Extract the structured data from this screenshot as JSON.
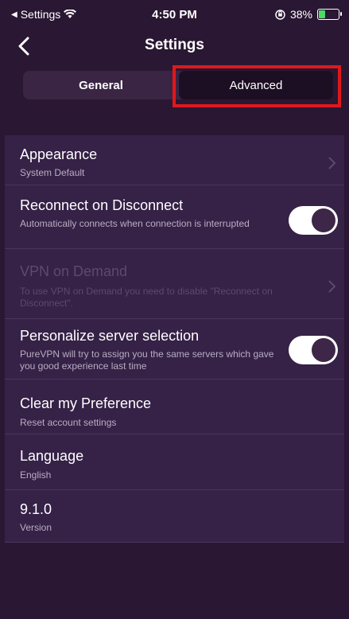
{
  "status_bar": {
    "back_app": "Settings",
    "time": "4:50 PM",
    "battery_percent": "38%",
    "battery_level": 0.38,
    "icons": [
      "back-arrow-icon",
      "wifi-icon",
      "orientation-lock-icon",
      "battery-charging-icon"
    ]
  },
  "nav": {
    "title": "Settings",
    "back_icon": "chevron-left-icon"
  },
  "tabs": [
    {
      "label": "General",
      "selected": false
    },
    {
      "label": "Advanced",
      "selected": true
    }
  ],
  "settings": [
    {
      "title": "Appearance",
      "subtitle": "System Default",
      "control": "chevron",
      "enabled": true
    },
    {
      "title": "Reconnect on Disconnect",
      "subtitle": "Automatically connects when connection is interrupted",
      "control": "toggle",
      "toggle_on": true,
      "enabled": true
    },
    {
      "title": "VPN on Demand",
      "subtitle": "To use VPN on Demand you need to disable \"Reconnect on Disconnect\".",
      "control": "chevron",
      "enabled": false
    },
    {
      "title": "Personalize server selection",
      "subtitle": "PureVPN will try to assign you the same servers which gave you good experience last time",
      "control": "toggle",
      "toggle_on": true,
      "enabled": true
    },
    {
      "title": "Clear my Preference",
      "subtitle": "Reset account settings",
      "control": "none",
      "enabled": true
    },
    {
      "title": "Language",
      "subtitle": "English",
      "control": "none",
      "enabled": true
    },
    {
      "title": "9.1.0",
      "subtitle": "Version",
      "control": "none",
      "enabled": true
    }
  ],
  "colors": {
    "background": "#2a1733",
    "list_background": "#362147",
    "highlight": "#e0181b",
    "toggle_on": "#ffffff"
  }
}
